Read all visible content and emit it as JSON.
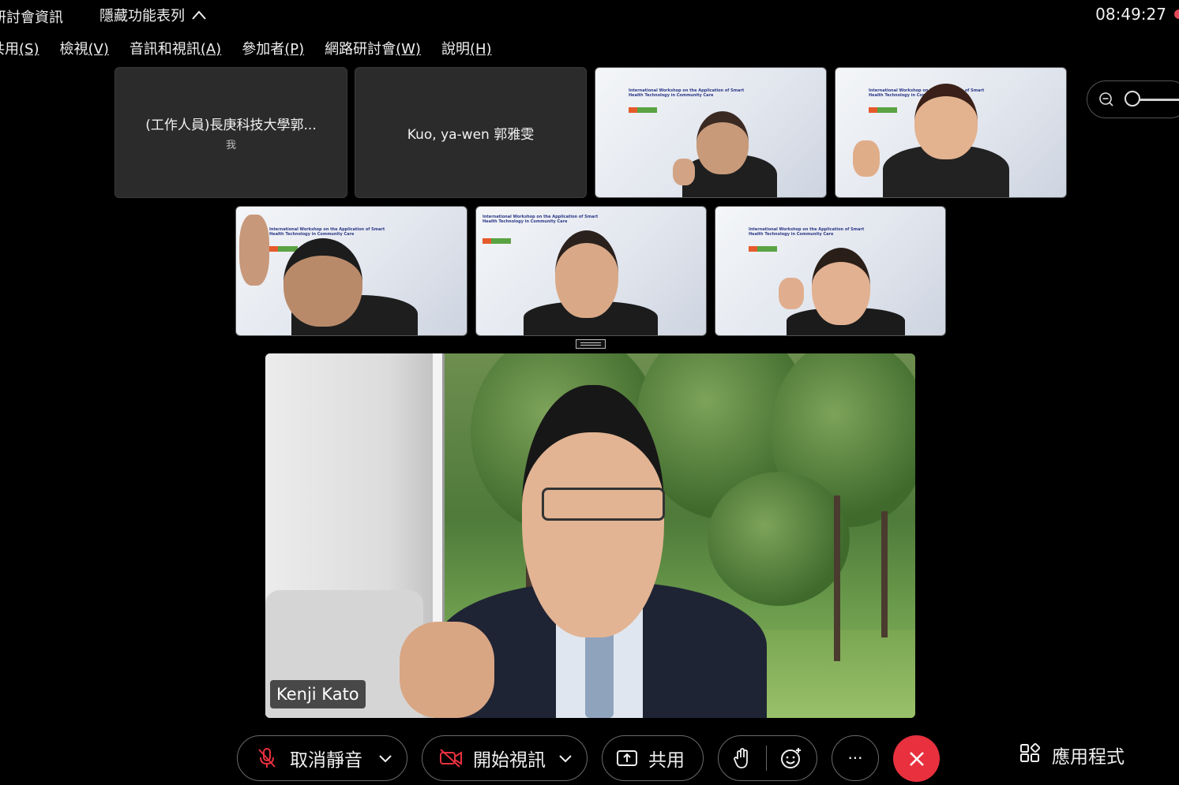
{
  "top_bar": {
    "title": "研討會資訊",
    "hide_toolbar_label": "隱藏功能表列",
    "clock": "08:49:27"
  },
  "menu": [
    {
      "label": "共用",
      "key": "(S)"
    },
    {
      "label": "檢視",
      "key": "(V)"
    },
    {
      "label": "音訊和視訊",
      "key": "(A)"
    },
    {
      "label": "參加者",
      "key": "(P)"
    },
    {
      "label": "網路研討會",
      "key": "(W)"
    },
    {
      "label": "說明",
      "key": "(H)"
    }
  ],
  "tiles": {
    "tile1": {
      "name": "(工作人員)長庚科技大學郭...",
      "sub": "我"
    },
    "tile2": {
      "name": "Kuo, ya-wen 郭雅雯"
    },
    "slide_text": "International Workshop on the Application of Smart Health Technology in Community Care"
  },
  "main_video": {
    "name": "Kenji Kato"
  },
  "toolbar": {
    "mute_label": "取消靜音",
    "video_label": "開始視訊",
    "share_label": "共用",
    "more_label": "···",
    "apps_label": "應用程式"
  },
  "colors": {
    "end_button": "#e8303e",
    "background": "#000000",
    "tile": "#2b2b2b"
  }
}
